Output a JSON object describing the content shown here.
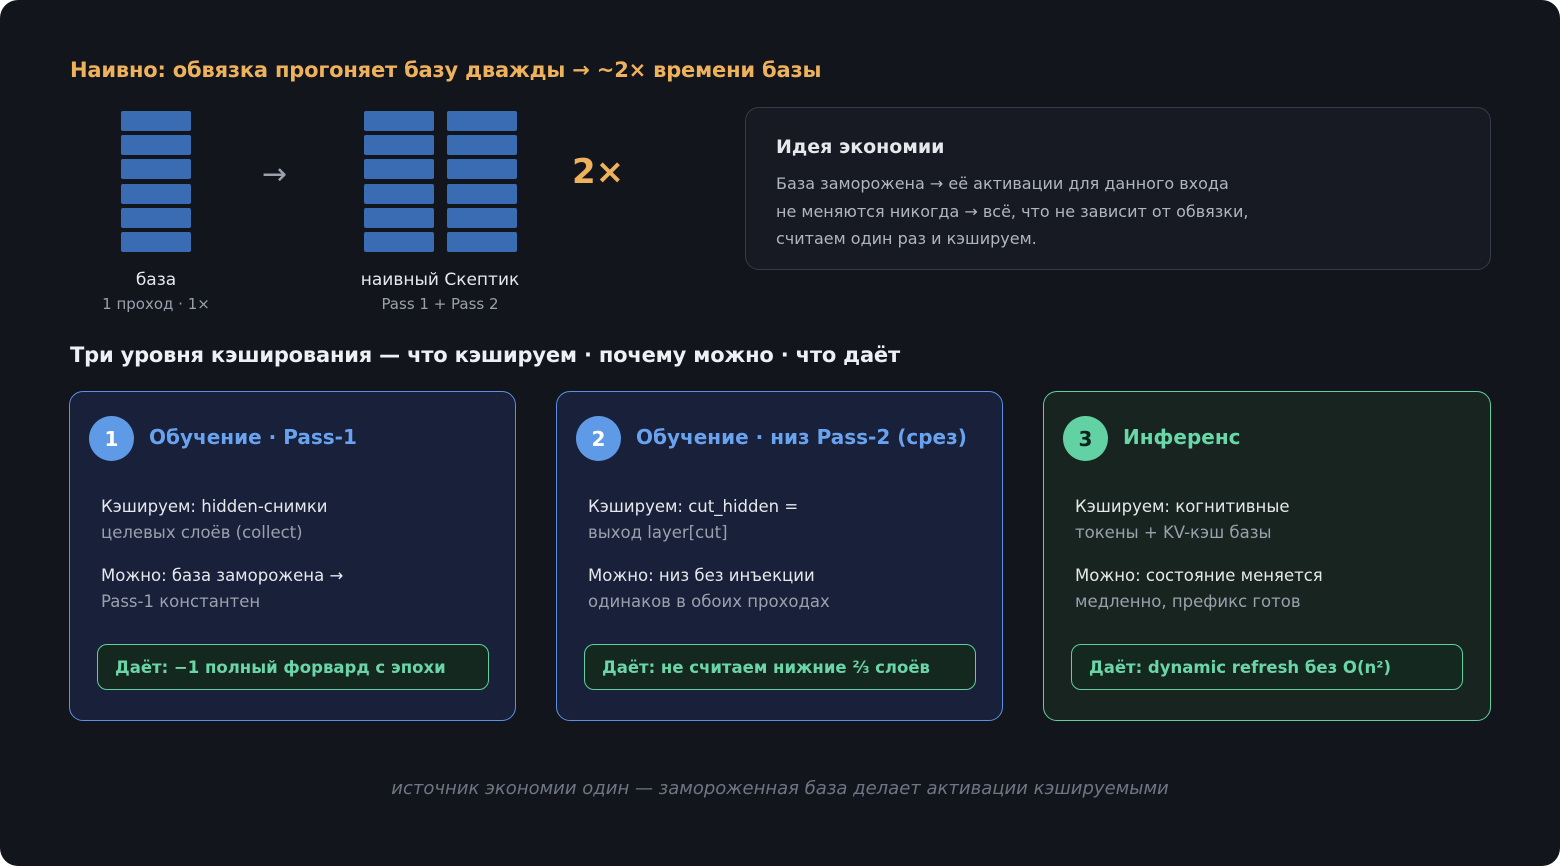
{
  "naive": {
    "heading": "Наивно: обвязка прогоняет базу дважды → ~2× времени базы",
    "arrow": "→",
    "multiplier": "2×",
    "base_label": "база",
    "base_sub": "1 проход · 1×",
    "naive_label": "наивный Скептик",
    "naive_sub": "Pass 1 + Pass 2"
  },
  "idea": {
    "title": "Идея экономии",
    "lines": [
      "База заморожена → её активации для данного входа",
      "не меняются никогда → всё, что не зависит от обвязки,",
      "считаем один раз и кэшируем."
    ]
  },
  "levels_heading": "Три уровня кэширования — что кэшируем · почему можно · что даёт",
  "cards": [
    {
      "number": "1",
      "title": "Обучение · Pass-1",
      "cache_main": "Кэшируем: hidden-снимки",
      "cache_sub": "целевых слоёв (collect)",
      "why_main": "Можно: база заморожена →",
      "why_sub": "Pass-1 константен",
      "gives": "Даёт: −1 полный форвард с эпохи"
    },
    {
      "number": "2",
      "title": "Обучение · низ Pass-2 (срез)",
      "cache_main": "Кэшируем: cut_hidden =",
      "cache_sub": "выход layer[cut]",
      "why_main": "Можно: низ без инъекции",
      "why_sub": "одинаков в обоих проходах",
      "gives": "Даёт: не считаем нижние ⅔ слоёв"
    },
    {
      "number": "3",
      "title": "Инференс",
      "cache_main": "Кэшируем: когнитивные",
      "cache_sub": "токены + KV-кэш базы",
      "why_main": "Можно: состояние меняется",
      "why_sub": "медленно, префикс готов",
      "gives": "Даёт: dynamic refresh без O(n²)"
    }
  ],
  "footer": "источник экономии один — замороженная база делает активации кэшируемыми",
  "colors": {
    "accent_orange": "#eeb15c",
    "layer_blue": "#3a6cb3",
    "card_blue": "#5d8fe2",
    "card_green": "#5fcf9e"
  }
}
